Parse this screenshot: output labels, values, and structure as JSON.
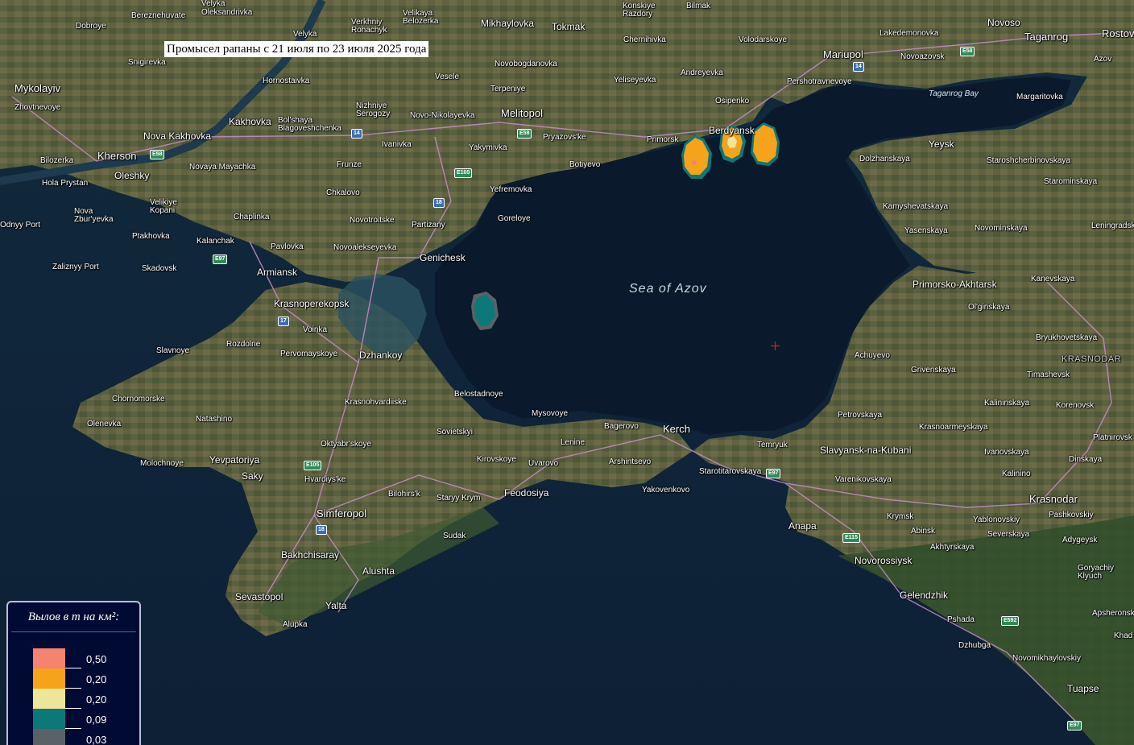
{
  "title": "Промысел рапаны с 21 июля по 23 июля 2025 года",
  "colors": {
    "sea": "#0a1e33",
    "land": "#4f5a3a",
    "roads": "#c88cc8",
    "catch_050": "#f4836f",
    "catch_020_orange": "#f5a31a",
    "catch_020_yellow": "#ede59a",
    "catch_009": "#0d7878",
    "catch_003": "#5a6268"
  },
  "legend": {
    "title": "Вылов в т на км²:",
    "items": [
      {
        "value": "0,50",
        "color": "#f4836f"
      },
      {
        "value": "0,20",
        "color": "#f5a31a"
      },
      {
        "value": "0,20",
        "color": "#ede59a"
      },
      {
        "value": "0,09",
        "color": "#0d7878"
      },
      {
        "value": "0,03",
        "color": "#5a6268"
      }
    ]
  },
  "labels": {
    "sea_of_azov": "Sea of Azov",
    "taganrog_bay": "Taganrog Bay",
    "krasnodar_region": "KRASNODAR",
    "places": [
      "Velyka",
      "Bereznehuvate",
      "Oleksandrivka",
      "Dobroye",
      "Velyka",
      "Verkhniy Rohachyk",
      "Velikaya Belozerka",
      "Mikhaylovka",
      "Tokmak",
      "Konskiye Razdory",
      "Bilmak",
      "Novoso",
      "Taganrog",
      "Rostov",
      "Novoazovsk",
      "Lakedemonovka",
      "Snigirevka",
      "Novobogdanovka",
      "Chernihivka",
      "Volodarskoye",
      "Mariupol",
      "Azov",
      "Mykolayiv",
      "Zhovtnevoye",
      "Hornostaivka",
      "Vesele",
      "Terpeniye",
      "Andreyevka",
      "Yeliseyevka",
      "Pershotravnevoye",
      "Margaritovka",
      "Kakhovka",
      "Nizhniye Serogozy",
      "Bol'shaya Blagoveshchenka",
      "Novo-Nikolayevka",
      "Melitopol",
      "Osipenko",
      "Nova Kakhovka",
      "Kherson",
      "Ivanivka",
      "Pryazovs'ke",
      "Yakymivka",
      "Primorsk",
      "Berdyansk",
      "Yeysk",
      "Bilozerka",
      "Oleshky",
      "Novaya Mayachka",
      "Frunze",
      "Botiyevo",
      "Dolzhanskaya",
      "Staroshcherbinovskaya",
      "Hola Prystan",
      "Chkalovo",
      "Yefremovka",
      "Starominskaya",
      "Velikiye Kopani",
      "Novotroitske",
      "Goreloye",
      "Kamyshevatskaya",
      "Odnyy Port",
      "Nova Zbur'yevka",
      "Chaplinka",
      "Partizany",
      "Yasenskaya",
      "Novominskaya",
      "Leningradskaya",
      "Ptakhovka",
      "Kalanchak",
      "Pavlovka",
      "Novoalekseyevka",
      "Genichesk",
      "Zaliznyy Port",
      "Skadovsk",
      "Armiansk",
      "Primorsko-Akhtarsk",
      "Kanevskaya",
      "Krasnoperekopsk",
      "Voinka",
      "Ol'ginskaya",
      "Slavnoye",
      "Rozdolne",
      "Pervomayskoye",
      "Dzhankoy",
      "Bryukhovetskaya",
      "Achuyevo",
      "Grivenskaya",
      "Timashevsk",
      "Belostadnoye",
      "Chornomorske",
      "Krasnohvardiiske",
      "Kalininskaya",
      "Natashino",
      "Olenevka",
      "Mysovoye",
      "Korenovsk",
      "Petrovskaya",
      "Sovietskyi",
      "Bagerovo",
      "Kerch",
      "Lenine",
      "Krasnoarmeyskaya",
      "Oktyabr'skoye",
      "Temryuk",
      "Slavyansk-na-Kubani",
      "Platnirovsk",
      "Ivanovskaya",
      "Yevpatoriya",
      "Molochnoye",
      "Kirovskoye",
      "Uvarovo",
      "Arshintsevo",
      "Dinskaya",
      "Saky",
      "Starotitarovskaya",
      "Varenikovskaya",
      "Kalinino",
      "Hvardiys'ke",
      "Bilohirs'k",
      "Feodosiya",
      "Yakovenkovo",
      "Staryy Krym",
      "Krasnodar",
      "Simferopol",
      "Krymsk",
      "Pashkovskiy",
      "Yablonovskiy",
      "Anapa",
      "Abinsk",
      "Severskaya",
      "Sudak",
      "Adygeysk",
      "Akhtyrskaya",
      "Bakhchisaray",
      "Novorossiysk",
      "Alushta",
      "Goryachiy Klyuch",
      "Sevastopol",
      "Gelendzhik",
      "Yalta",
      "Apsheronsk",
      "Alupka",
      "Pshada",
      "Khad",
      "Dzhubga",
      "Novomikhaylovskiy",
      "Tuapse"
    ],
    "route_shields": [
      "E58",
      "E58",
      "E58",
      "14",
      "14",
      "E105",
      "18",
      "E97",
      "17",
      "E105",
      "18",
      "E97",
      "E115",
      "E592",
      "E97"
    ]
  }
}
